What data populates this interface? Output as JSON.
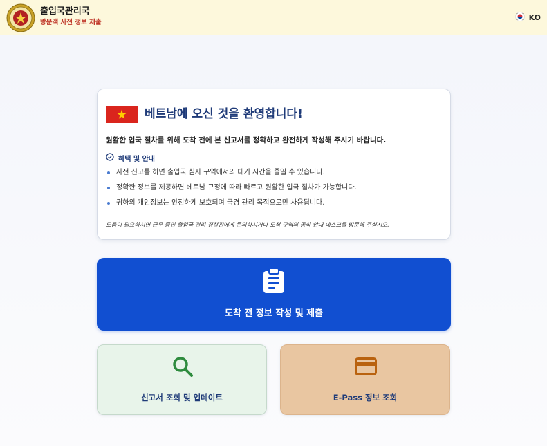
{
  "header": {
    "title": "출입국관리국",
    "subtitle": "방문객 사전 정보 제출",
    "language": "KO",
    "logo_icon": "immigration-emblem",
    "flag_icon": "south-korea-flag-icon"
  },
  "welcome_card": {
    "flag_icon": "vietnam-flag-icon",
    "title": "베트남에 오신 것을 환영합니다!",
    "intro": "원활한 입국 절차를 위해 도착 전에 본 신고서를 정확하고 완전하게 작성해 주시기 바랍니다.",
    "benefits_heading": "혜택 및 안내",
    "benefits": [
      "사전 신고를 하면 출입국 심사 구역에서의 대기 시간을 줄일 수 있습니다.",
      "정확한 정보를 제공하면 베트남 규정에 따라 빠르고 원활한 입국 절차가 가능합니다.",
      "귀하의 개인정보는 안전하게 보호되며 국경 관리 목적으로만 사용됩니다."
    ],
    "help_note": "도움이 필요하시면 근무 중인 출입국 관리 경찰관에게 문의하시거나 도착 구역의 공식 안내 데스크를 방문해 주십시오."
  },
  "actions": {
    "primary": {
      "label": "도착 전 정보 작성 및 제출",
      "icon": "clipboard-icon"
    },
    "lookup": {
      "label": "신고서 조회 및 업데이트",
      "icon": "search-icon"
    },
    "epass": {
      "label": "E-Pass 정보 조회",
      "icon": "credit-card-icon"
    }
  },
  "colors": {
    "header_bg": "#fdf8dc",
    "primary": "#114fd1",
    "lookup_bg": "#e8f4ea",
    "epass_bg": "#e9c6a1",
    "title": "#1e3a78",
    "accent_red": "#c0392b"
  }
}
